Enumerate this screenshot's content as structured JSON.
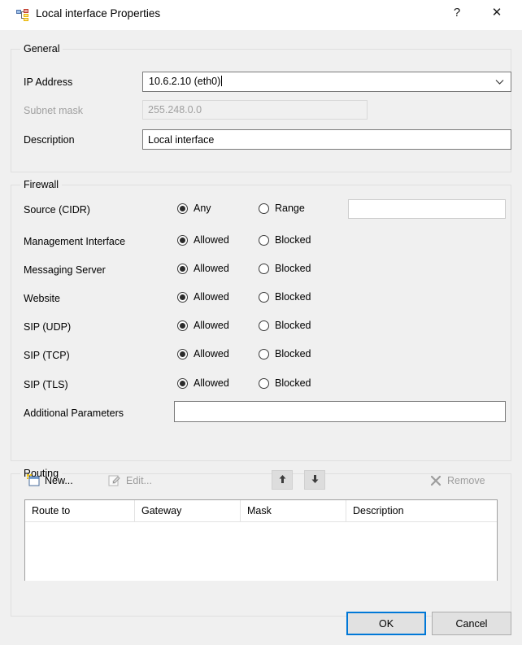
{
  "window": {
    "title": "Local interface Properties",
    "icon": "network-interface-icon",
    "help_label": "?",
    "close_label": "✕"
  },
  "general": {
    "legend": "General",
    "ip_address": {
      "label": "IP Address",
      "value": "10.6.2.10 (eth0)",
      "dropdown_icon": "chevron-down-icon"
    },
    "subnet_mask": {
      "label": "Subnet mask",
      "value": "255.248.0.0",
      "enabled": false
    },
    "description": {
      "label": "Description",
      "value": "Local interface",
      "placeholder": ""
    }
  },
  "firewall": {
    "legend": "Firewall",
    "source_cidr": {
      "label": "Source (CIDR)",
      "options": [
        "Any",
        "Range"
      ],
      "selected": "Any",
      "range_value": "",
      "range_placeholder": ""
    },
    "rules": [
      {
        "label": "Management Interface",
        "options": [
          "Allowed",
          "Blocked"
        ],
        "selected": "Allowed"
      },
      {
        "label": "Messaging Server",
        "options": [
          "Allowed",
          "Blocked"
        ],
        "selected": "Allowed"
      },
      {
        "label": "Website",
        "options": [
          "Allowed",
          "Blocked"
        ],
        "selected": "Allowed"
      },
      {
        "label": "SIP (UDP)",
        "options": [
          "Allowed",
          "Blocked"
        ],
        "selected": "Allowed"
      },
      {
        "label": "SIP (TCP)",
        "options": [
          "Allowed",
          "Blocked"
        ],
        "selected": "Allowed"
      },
      {
        "label": "SIP (TLS)",
        "options": [
          "Allowed",
          "Blocked"
        ],
        "selected": "Allowed"
      }
    ],
    "additional_parameters": {
      "label": "Additional Parameters",
      "value": "",
      "placeholder": ""
    }
  },
  "routing": {
    "legend": "Routing",
    "toolbar": {
      "new_label": "New...",
      "edit_label": "Edit...",
      "remove_label": "Remove",
      "move_up_icon": "arrow-up-icon",
      "move_down_icon": "arrow-down-icon",
      "new_enabled": true,
      "edit_enabled": false,
      "remove_enabled": false
    },
    "table": {
      "columns": [
        "Route to",
        "Gateway",
        "Mask",
        "Description"
      ],
      "rows": []
    }
  },
  "footer": {
    "ok_label": "OK",
    "cancel_label": "Cancel"
  },
  "colors": {
    "accent": "#0078d7",
    "dialog_bg": "#f0f0f0",
    "titlebar_bg": "#ffffff",
    "disabled_text": "#a0a0a0"
  }
}
